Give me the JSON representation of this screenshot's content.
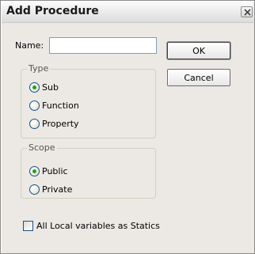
{
  "window": {
    "title": "Add Procedure"
  },
  "name_field": {
    "label": "Name:",
    "value": ""
  },
  "buttons": {
    "ok": "OK",
    "cancel": "Cancel"
  },
  "type_group": {
    "title": "Type",
    "options": [
      {
        "label": "Sub",
        "checked": true
      },
      {
        "label": "Function",
        "checked": false
      },
      {
        "label": "Property",
        "checked": false
      }
    ]
  },
  "scope_group": {
    "title": "Scope",
    "options": [
      {
        "label": "Public",
        "checked": true
      },
      {
        "label": "Private",
        "checked": false
      }
    ]
  },
  "statics_checkbox": {
    "label": "All Local variables as Statics",
    "checked": false
  },
  "icons": {
    "close": "close-icon"
  }
}
